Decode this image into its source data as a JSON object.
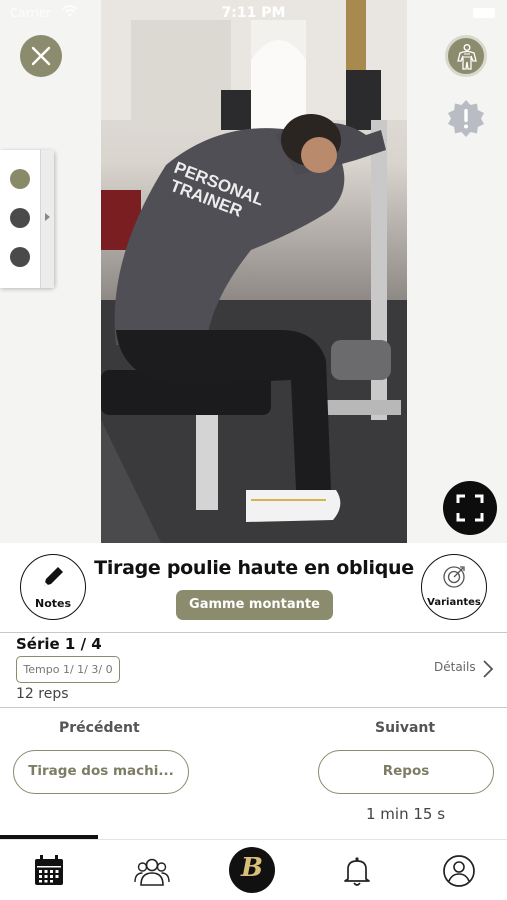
{
  "status_bar": {
    "carrier": "Carrier",
    "time": "7:11 PM"
  },
  "media": {
    "close_icon": "close-icon",
    "muscle_icon": "muscle-body-icon",
    "alert_icon": "warning-badge-icon",
    "fullscreen_icon": "fullscreen-icon",
    "colors": {
      "accent": "#8b8b6e",
      "dark": "#0d0d0d"
    }
  },
  "exercise": {
    "title": "Tirage poulie haute en oblique",
    "range_label": "Gamme montante",
    "notes_label": "Notes",
    "variantes_label": "Variantes"
  },
  "series": {
    "label": "Série 1 / 4",
    "tempo": "Tempo 1/ 1/ 3/ 0",
    "reps": "12 reps",
    "details": "Détails"
  },
  "navigation": {
    "previous_header": "Précédent",
    "next_header": "Suivant",
    "previous_exercise": "Tirage dos machi...",
    "next_exercise": "Repos",
    "rest_time": "1 min 15 s"
  },
  "tab_bar": {
    "items": [
      {
        "icon": "calendar-icon"
      },
      {
        "icon": "community-icon"
      },
      {
        "icon": "home-logo-icon",
        "letter": "B"
      },
      {
        "icon": "bell-icon"
      },
      {
        "icon": "profile-icon"
      }
    ]
  }
}
